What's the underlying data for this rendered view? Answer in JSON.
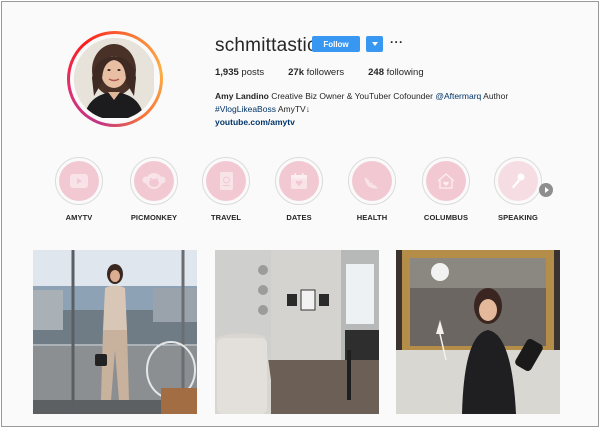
{
  "profile": {
    "username": "schmittastic",
    "follow_label": "Follow",
    "more_label": "···",
    "stats": {
      "posts_count": "1,935",
      "posts_label": "posts",
      "followers_count": "27k",
      "followers_label": "followers",
      "following_count": "248",
      "following_label": "following"
    },
    "bio": {
      "name": "Amy Landino",
      "text1": " Creative Biz Owner & YouTuber Cofounder ",
      "mention": "@Aftermarq",
      "text2": " Author",
      "hashtag": "#VlogLikeaBoss",
      "text3": " AmyTV↓",
      "link": "youtube.com/amytv"
    }
  },
  "highlights": [
    {
      "label": "AMYTV",
      "icon": "play-icon"
    },
    {
      "label": "PICMONKEY",
      "icon": "picmonkey-icon"
    },
    {
      "label": "TRAVEL",
      "icon": "passport-icon"
    },
    {
      "label": "DATES",
      "icon": "calendar-heart-icon"
    },
    {
      "label": "HEALTH",
      "icon": "melon-icon"
    },
    {
      "label": "COLUMBUS",
      "icon": "house-heart-icon"
    },
    {
      "label": "SPEAKING",
      "icon": "microphone-icon"
    }
  ],
  "colors": {
    "accent": "#3897f0",
    "highlight_fill": "#f2c9d2",
    "link": "#003569"
  }
}
